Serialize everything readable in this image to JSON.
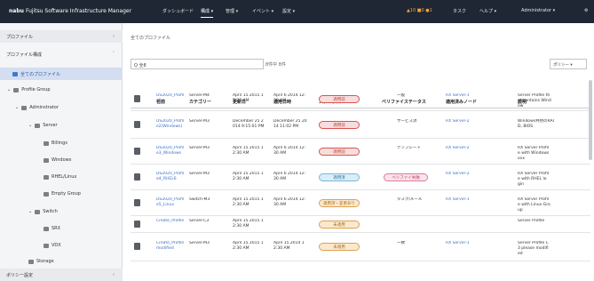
{
  "header": {
    "brand": "nabu",
    "title": "Fujitsu Software Infrastructure Manager",
    "nav": [
      "ダッシュボード",
      "構成 ▾",
      "管理 ▾",
      "イベント ▾",
      "設定 ▾"
    ],
    "alerts": "▲10  ■0  ●1",
    "status": "タスク",
    "help": "ヘルプ ▾",
    "user": "Administrator ▾"
  },
  "sidebar": {
    "items": [
      {
        "label": "プロファイル",
        "caret": "‹"
      },
      {
        "label": "プロファイル構成",
        "caret": "ˆ"
      },
      {
        "label": "全てのプロファイル"
      },
      {
        "label": "Profile Group"
      },
      {
        "label": "Adminstrator"
      },
      {
        "label": "Server"
      },
      {
        "label": "Billings"
      },
      {
        "label": "Windows"
      },
      {
        "label": "RHEL/Linux"
      },
      {
        "label": "Empty Group"
      },
      {
        "label": "Switch"
      },
      {
        "label": "SRX"
      },
      {
        "label": "VDX"
      },
      {
        "label": "Storage"
      },
      {
        "label": "ポリシー設定",
        "caret": "‹"
      }
    ]
  },
  "main": {
    "breadcrumb": "全てのプロファイル",
    "search_value": "Q 全8",
    "search_count": "8件中 8件",
    "filter_button": "ポリシー ▾",
    "columns": [
      "名前",
      "カテゴリー",
      "更新日",
      "適用日時",
      "ステータス",
      "ベリファイステータス",
      "適用済みノード",
      "説明"
    ],
    "rows": [
      {
        "name": "DS2020_Profil\ne1",
        "category": "Server-M4",
        "updated": "April 15 2015 1\n2:30 AM",
        "applied": "April 6 2014 12:\n30 AM",
        "status": "適用前",
        "verify": "一般",
        "node": "RX Server-1",
        "desc": "Server Profile th\nat contains Wind\now"
      },
      {
        "name": "DS2020_Profil\ne2(Windows)",
        "category": "Server-M3",
        "updated": "December 25 2\n014 9:15:01 PM",
        "applied": "December 25 20\n14 11:02 PM",
        "status": "適用前",
        "verify": "サービス済",
        "node": "RX Server-2",
        "desc": "Windows共用のRAI\nD, BIOS"
      },
      {
        "name": "DS2020_Profil\ne3_Windows",
        "category": "Server-M3",
        "updated": "April 15 2015 1\n2:30 AM",
        "applied": "April 6 2014 12:\n30 AM",
        "status": "適用前",
        "verify": "テンプレート",
        "node": "RX Server-2",
        "desc": "RX Server Profil\ne with Windows\nxxx"
      },
      {
        "name": "DS2020_Profil\ne4_RHEL6",
        "category": "Server-M3",
        "updated": "April 15 2015 1\n2:30 AM",
        "applied": "April 6 2014 12:\n30 AM",
        "status": "適用済",
        "verify": "ベリファイ失敗",
        "node": "RX Server-2",
        "desc": "RX Server Profil\ne with RHEL lo\ngin"
      },
      {
        "name": "DS2020_Profil\ne5_Linux",
        "category": "Switch-M3",
        "updated": "April 15 2015 1\n2:30 AM",
        "applied": "April 6 2014 12:\n30 AM",
        "status": "適用済・変更あり",
        "verify": "タスク/ルール",
        "node": "RX Server-1",
        "desc": "RX Server Profil\ne with Linux Gro\nup"
      },
      {
        "name": "Create_Profile\n",
        "category": "Server-C3",
        "updated": "April 15 2015 1\n2:30 AM",
        "applied": "",
        "status": "未適用",
        "verify": "",
        "node": "",
        "desc": "Server Profile"
      },
      {
        "name": "Create_Profile\nmodified",
        "category": "Server-M3",
        "updated": "April 15 2015 1\n2:30 AM",
        "applied": "April 15 2014 1\n2:30 AM",
        "status": "未適用",
        "verify": "一致",
        "node": "RX Server-1",
        "desc": "Server Profile C\n3 please modifi\ned"
      }
    ]
  },
  "colors": {
    "header_bg": "#1e2733",
    "accent": "#3a6fc4"
  }
}
